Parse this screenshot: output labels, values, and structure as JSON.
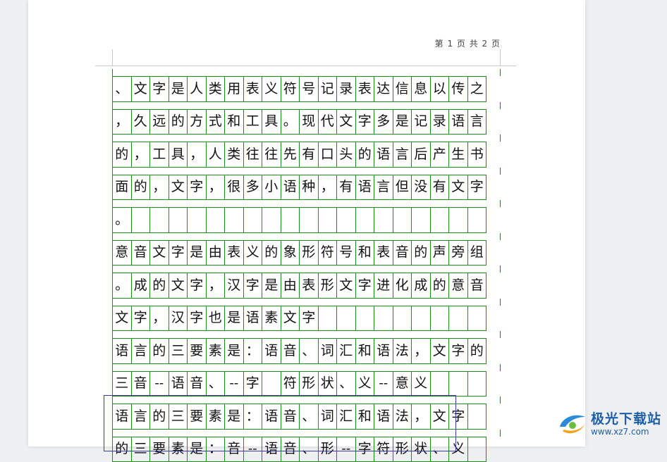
{
  "header": {
    "page_info": "第 1 页 共 2 页"
  },
  "lines": [
    [
      "、",
      "文",
      "字",
      "是",
      "人",
      "类",
      "用",
      "表",
      "义",
      "符",
      "号",
      "记",
      "录",
      "表",
      "达",
      "信",
      "息",
      "以",
      "传",
      "之"
    ],
    [
      "，",
      "久",
      "远",
      "的",
      "方",
      "式",
      "和",
      "工",
      "具",
      "。",
      "现",
      "代",
      "文",
      "字",
      "多",
      "是",
      "记",
      "录",
      "语",
      "言"
    ],
    [
      "的",
      "，",
      "工",
      "具",
      "，",
      "人",
      "类",
      "往",
      "往",
      "先",
      "有",
      "口",
      "头",
      "的",
      "语",
      "言",
      "后",
      "产",
      "生",
      "书"
    ],
    [
      "面",
      "的",
      "，",
      "文",
      "字",
      "，",
      "很",
      "多",
      "小",
      "语",
      "种",
      "，",
      "有",
      "语",
      "言",
      "但",
      "没",
      "有",
      "文",
      "字"
    ],
    [
      "。",
      "",
      "",
      "",
      "",
      "",
      "",
      "",
      "",
      "",
      "",
      "",
      "",
      "",
      "",
      "",
      "",
      "",
      "",
      ""
    ],
    [
      "意",
      "音",
      "文",
      "字",
      "是",
      "由",
      "表",
      "义",
      "的",
      "象",
      "形",
      "符",
      "号",
      "和",
      "表",
      "音",
      "的",
      "声",
      "旁",
      "组"
    ],
    [
      "。",
      "成",
      "的",
      "文",
      "字",
      "，",
      "汉",
      "字",
      "是",
      "由",
      "表",
      "形",
      "文",
      "字",
      "进",
      "化",
      "成",
      "的",
      "意",
      "音"
    ],
    [
      "文",
      "字",
      "，",
      "汉",
      "字",
      "也",
      "是",
      "语",
      "素",
      "文",
      "字",
      "",
      "",
      "",
      "",
      "",
      "",
      "",
      "",
      ""
    ],
    [
      "语",
      "言",
      "的",
      "三",
      "要",
      "素",
      "是",
      "：",
      "语",
      "音",
      "、",
      "词",
      "汇",
      "和",
      "语",
      "法",
      "，",
      "文",
      "字",
      "的"
    ],
    [
      "三",
      "音",
      "--",
      "语",
      "音",
      "、",
      "--",
      "字",
      "",
      "符",
      "形",
      "状",
      "、",
      "义",
      "--",
      "意",
      "义",
      "",
      "",
      ""
    ],
    [
      "语",
      "言",
      "的",
      "三",
      "要",
      "素",
      "是",
      "：",
      "语",
      "音",
      "、",
      "词",
      "汇",
      "和",
      "语",
      "法",
      "，",
      "文",
      "字",
      ""
    ],
    [
      "的",
      "三",
      "要",
      "素",
      "是",
      "：",
      "音",
      "--",
      "语",
      "音",
      "、",
      "形",
      "--",
      "字",
      "符",
      "形",
      "状",
      "、",
      "义",
      ""
    ]
  ],
  "watermark": {
    "title": "极光下载站",
    "url": "www.xz7.com",
    "brand_color": "#1e5fa8"
  },
  "colors": {
    "grid": "#1f8a1f",
    "selection": "#3b3b9e"
  }
}
